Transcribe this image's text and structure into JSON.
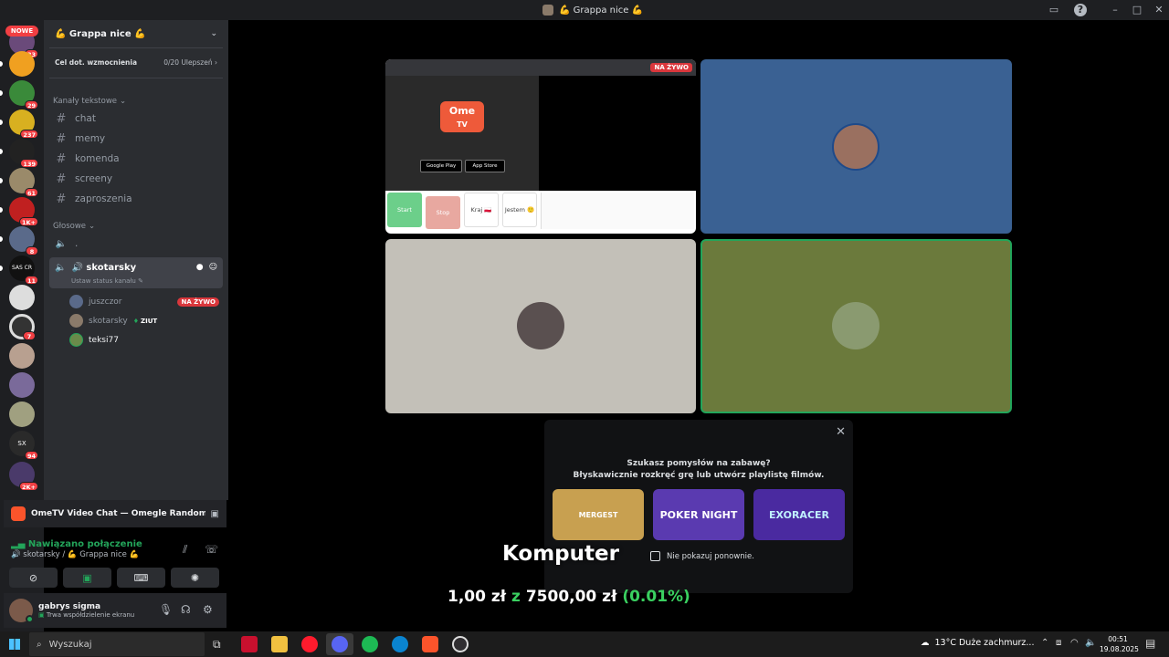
{
  "window": {
    "title": "💪 Grappa nice 💪"
  },
  "guilds": {
    "new_label": "NOWE",
    "badges": [
      "33",
      "29",
      "237",
      "139",
      "61",
      "1K+",
      "8",
      "11",
      "7",
      "94",
      "2K+"
    ],
    "labels": [
      "SAS CR",
      "SX"
    ]
  },
  "server": {
    "name": "💪 Grappa nice 💪"
  },
  "boost": {
    "label": "Cel dot. wzmocnienia",
    "progress": "0/20 Ulepszeń"
  },
  "text_category": "Kanały tekstowe",
  "text_channels": [
    "chat",
    "memy",
    "komenda",
    "screeny",
    "zaproszenia"
  ],
  "voice_category": "Głosowe",
  "voice_channels": {
    "first": ".",
    "active": "🔊 skotarsky",
    "active_status": "Ustaw status kanału"
  },
  "voice_users": [
    {
      "name": "juszczor",
      "badge": "NA ŻYWO"
    },
    {
      "name": "skotarsky",
      "badge": "ZIUT"
    },
    {
      "name": "teksi77",
      "badge": ""
    }
  ],
  "activity": {
    "title": "OmeTV Video Chat — Omegle Random Ca..."
  },
  "rtc": {
    "status": "Nawiązano połączenie",
    "channel": "🔊 skotarsky / 💪 Grappa nice 💪"
  },
  "user": {
    "name": "gabrys sigma",
    "status": "Trwa współdzielenie ekranu"
  },
  "stream": {
    "live_label": "NA ŻYWO",
    "ome_logo": "Ome",
    "ome_tv": "TV",
    "google_play": "Google Play",
    "app_store": "App Store",
    "buttons": [
      "Start",
      "Stop",
      "Kraj 🇵🇱",
      "Jestem 🙂"
    ]
  },
  "popup": {
    "line1": "Szukasz pomysłów na zabawę?",
    "line2": "Błyskawicznie rozkręć grę lub utwórz playlistę filmów.",
    "games": [
      "MERGEST",
      "POKER NIGHT",
      "EXORACER"
    ],
    "checkbox_label": "Nie pokazuj ponownie."
  },
  "overlay": {
    "title": "Komputer",
    "money_prefix": "1,00 zł",
    "money_z": "z",
    "money_total": "7500,00 zł",
    "money_pct": "(0.01%)"
  },
  "taskbar": {
    "search_placeholder": "Wyszukaj",
    "weather": "13°C  Duże zachmurz...",
    "time": "00:51",
    "date": "19.08.2025"
  },
  "colors": {
    "accent_green": "#23a55a",
    "live_red": "#da373c",
    "tile_blue": "#3a6193",
    "tile_grey": "#c3c0b8",
    "tile_olive": "#6b7a3c"
  }
}
